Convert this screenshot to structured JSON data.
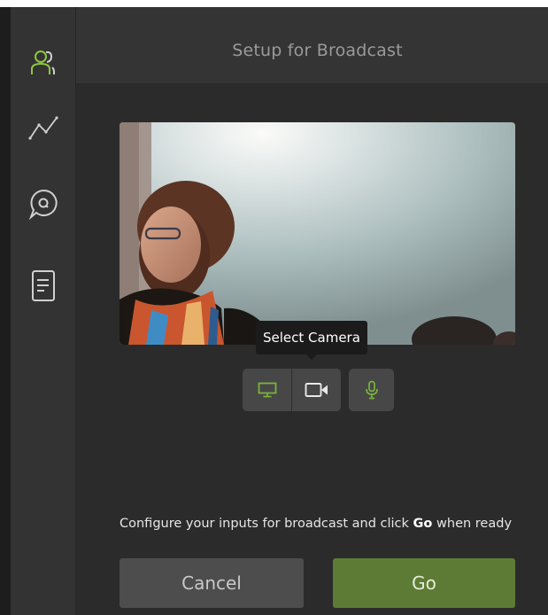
{
  "header": {
    "title": "Setup for Broadcast"
  },
  "sidebar": {
    "items": [
      {
        "icon": "participants-icon"
      },
      {
        "icon": "analytics-icon"
      },
      {
        "icon": "chat-icon"
      },
      {
        "icon": "document-icon"
      }
    ]
  },
  "preview": {
    "tooltip": "Select Camera"
  },
  "source_buttons": [
    {
      "icon": "monitor-icon",
      "active": true
    },
    {
      "icon": "camera-icon",
      "active": false
    },
    {
      "icon": "microphone-icon",
      "active": true
    }
  ],
  "instructions": {
    "prefix": "Configure your inputs for broadcast and click ",
    "emphasis": "Go",
    "suffix": " when ready"
  },
  "actions": {
    "cancel_label": "Cancel",
    "go_label": "Go"
  },
  "colors": {
    "accent_green": "#7ab43a",
    "go_button": "#5e7b35",
    "cancel_button": "#4d4d4d"
  }
}
